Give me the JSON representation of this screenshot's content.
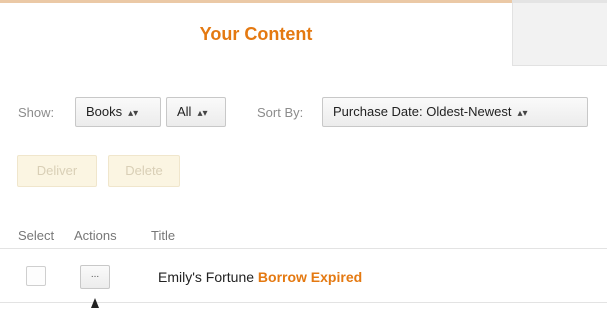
{
  "tabs": {
    "active_label": "Your Content",
    "inactive_label": ""
  },
  "filters": {
    "show_label": "Show:",
    "type_selected": "Books",
    "scope_selected": "All",
    "sort_label": "Sort By:",
    "sort_selected": "Purchase Date: Oldest-Newest"
  },
  "actions": {
    "deliver_label": "Deliver",
    "delete_label": "Delete"
  },
  "table": {
    "columns": [
      "Select",
      "Actions",
      "Title"
    ],
    "rows": [
      {
        "more_label": "...",
        "title": "Emily's Fortune",
        "status": "Borrow Expired"
      }
    ]
  },
  "colors": {
    "accent": "#e47911",
    "disabled_button_bg": "#fbf5e2"
  },
  "icons": {
    "dropdown_caret": "updown-caret-icon",
    "cursor": "mouse-pointer-icon"
  }
}
